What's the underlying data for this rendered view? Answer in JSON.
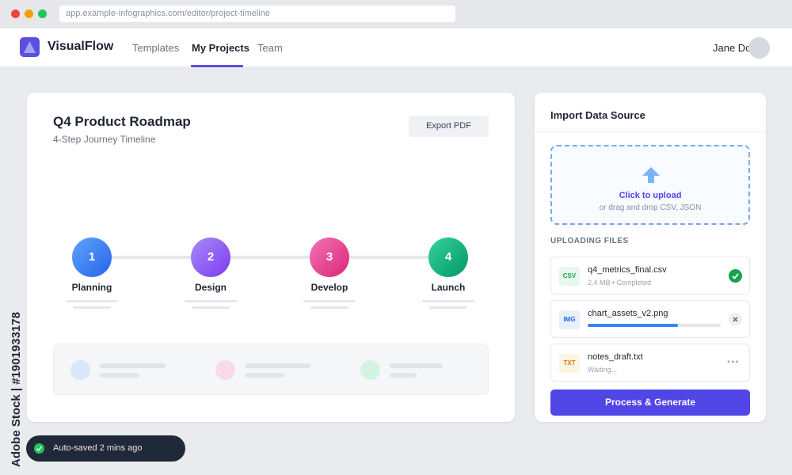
{
  "browser": {
    "url": "app.example-infographics.com/editor/project-timeline"
  },
  "app": {
    "brand": "VisualFlow",
    "nav": [
      {
        "label": "Templates",
        "active": false
      },
      {
        "label": "My Projects",
        "active": true
      },
      {
        "label": "Team",
        "active": false
      }
    ],
    "user": "Jane Doe",
    "accent": "#5b4fe0"
  },
  "main": {
    "title": "Q4 Product Roadmap",
    "subtitle": "4-Step Journey Timeline",
    "export_label": "Export PDF",
    "steps": [
      {
        "number": "1",
        "label": "Planning",
        "color": "#3b82f6"
      },
      {
        "number": "2",
        "label": "Design",
        "color": "#8b5cf6"
      },
      {
        "number": "3",
        "label": "Develop",
        "color": "#ec4899"
      },
      {
        "number": "4",
        "label": "Launch",
        "color": "#10b981"
      }
    ]
  },
  "import": {
    "title": "Import Data Source",
    "upload_main": "Click to upload",
    "upload_sub": "or drag and drop CSV, JSON",
    "uploading_label": "UPLOADING FILES",
    "files": [
      {
        "badge": "CSV",
        "name": "q4_metrics_final.csv",
        "meta": "2.4 MB • Completed",
        "status": "completed",
        "icon": "check-icon"
      },
      {
        "badge": "IMG",
        "name": "chart_assets_v2.png",
        "progress": 0.68,
        "status": "uploading",
        "icon": "close-icon"
      },
      {
        "badge": "TXT",
        "name": "notes_draft.txt",
        "meta": "Waiting...",
        "status": "waiting",
        "icon": "more-icon"
      }
    ],
    "process_label": "Process & Generate"
  },
  "toast": {
    "text": "Auto-saved 2 mins ago"
  },
  "credit": "Adobe Stock | #1901933178"
}
